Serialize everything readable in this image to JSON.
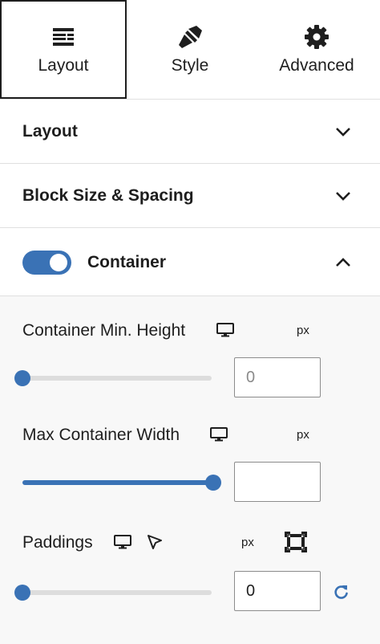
{
  "tabs": [
    {
      "label": "Layout",
      "icon": "layout-icon",
      "active": true
    },
    {
      "label": "Style",
      "icon": "brush-icon",
      "active": false
    },
    {
      "label": "Advanced",
      "icon": "gear-icon",
      "active": false
    }
  ],
  "panels": {
    "layout": {
      "title": "Layout",
      "state": "collapsed"
    },
    "block_size": {
      "title": "Block Size & Spacing",
      "state": "collapsed"
    },
    "container": {
      "title": "Container",
      "state": "expanded",
      "enabled": true
    }
  },
  "controls": {
    "min_height": {
      "label": "Container Min. Height",
      "unit": "px",
      "value": "0",
      "slider_level": 0
    },
    "max_width": {
      "label": "Max Container Width",
      "unit": "px",
      "value": "",
      "slider_level": 1
    },
    "paddings": {
      "label": "Paddings",
      "unit": "px",
      "value": "0",
      "slider_level": 0
    }
  },
  "colors": {
    "accent": "#3a72b5",
    "track": "#dddddd",
    "panel_bg": "#f8f8f8",
    "border": "#e0e0e0"
  }
}
